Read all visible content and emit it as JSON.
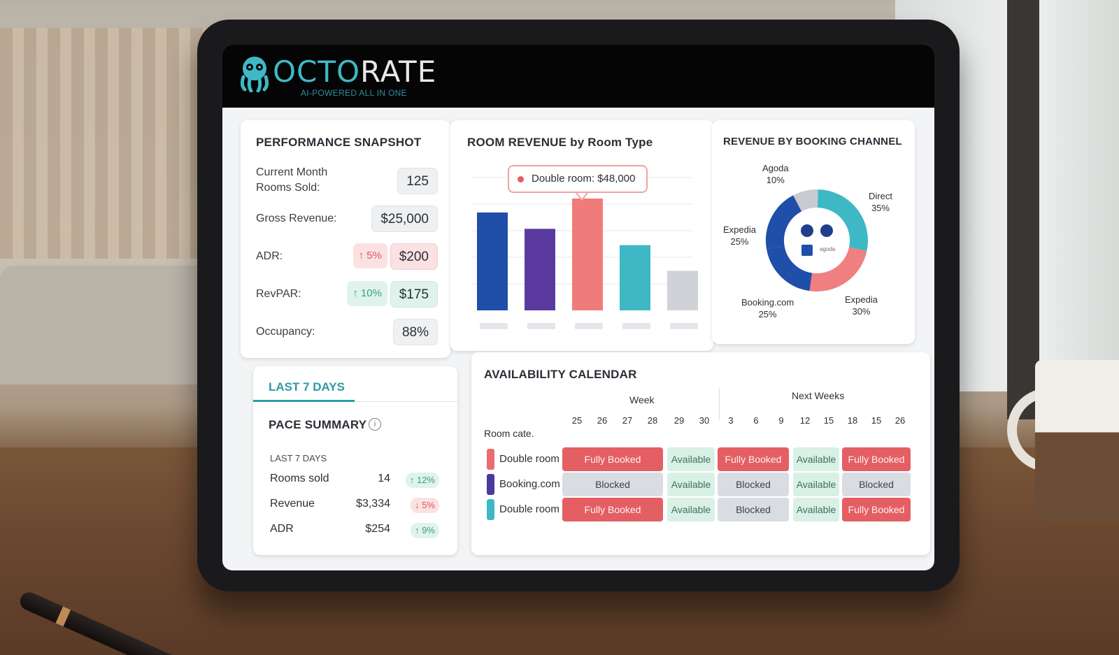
{
  "brand": {
    "name_accent": "OCTO",
    "name_rest": "RATE",
    "tagline": "AI-POWERED ALL IN ONE"
  },
  "performance": {
    "title": "PERFORMANCE SNAPSHOT",
    "rows": [
      {
        "label": "Current Month\nRooms Sold:",
        "value": "125"
      },
      {
        "label": "Gross Revenue:",
        "value": "$25,000"
      },
      {
        "label": "ADR:",
        "value": "$200",
        "delta": "↑ 5%"
      },
      {
        "label": "RevPAR:",
        "value": "$175",
        "delta": "↑ 10%"
      },
      {
        "label": "Occupancy:",
        "value": "88%"
      }
    ]
  },
  "room_revenue": {
    "title": "ROOM REVENUE by Room Type",
    "tooltip": "Double room: $48,000"
  },
  "channels": {
    "title": "REVENUE BY BOOKING CHANNEL",
    "labels": [
      {
        "name": "Agoda",
        "pct": "10%"
      },
      {
        "name": "Direct",
        "pct": "35%"
      },
      {
        "name": "Expedia",
        "pct": "25%"
      },
      {
        "name": "Booking.com",
        "pct": "25%"
      },
      {
        "name": "Expedia",
        "pct": "30%"
      }
    ],
    "center_text": "agoda"
  },
  "pace": {
    "tab": "LAST 7 DAYS",
    "title": "PACE SUMMARY",
    "info": "i",
    "subtitle": "LAST 7 DAYS",
    "rows": [
      {
        "name": "Rooms sold",
        "value": "14",
        "change": "↑ 12%"
      },
      {
        "name": "Revenue",
        "value": "$3,334",
        "change": "↓ 5%"
      },
      {
        "name": "ADR",
        "value": "$254",
        "change": "↑ 9%"
      }
    ]
  },
  "availability": {
    "title": "AVAILABILITY CALENDAR",
    "week_label": "Week",
    "next_label": "Next Weeks",
    "room_header": "Room cate.",
    "days": [
      "25",
      "26",
      "27",
      "28",
      "29",
      "30",
      "3",
      "6",
      "9",
      "12",
      "15",
      "18",
      "15",
      "26"
    ],
    "rooms": [
      {
        "name": "Double room",
        "color": "#e86d71",
        "cells": [
          "Fully Booked",
          "Available",
          "Fully Booked",
          "Available",
          "Fully Booked"
        ]
      },
      {
        "name": "Booking.com",
        "color": "#4a3a9b",
        "cells": [
          "Blocked",
          "Available",
          "Blocked",
          "Available",
          "Blocked"
        ]
      },
      {
        "name": "Double room",
        "color": "#3fb8c6",
        "cells": [
          "Fully Booked",
          "Available",
          "Blocked",
          "Available",
          "Fully Booked"
        ]
      }
    ]
  },
  "chart_data": [
    {
      "type": "bar",
      "title": "ROOM REVENUE by Room Type",
      "categories": [
        "",
        "",
        "",
        "",
        ""
      ],
      "values": [
        42000,
        35000,
        48000,
        28000,
        17000
      ],
      "colors": [
        "#1f4fa8",
        "#5b3aa0",
        "#f07b7b",
        "#3fb8c6",
        "#cfd3d8"
      ],
      "ylim": [
        0,
        60000
      ]
    },
    {
      "type": "pie",
      "title": "REVENUE BY BOOKING CHANNEL",
      "categories": [
        "Direct",
        "Expedia",
        "Booking.com",
        "Expedia",
        "Agoda"
      ],
      "values": [
        35,
        30,
        25,
        25,
        10
      ],
      "colors": [
        "#3fb8c6",
        "#f08080",
        "#1f4fa8",
        "#1f4fa8",
        "#c7cbd1"
      ]
    }
  ]
}
